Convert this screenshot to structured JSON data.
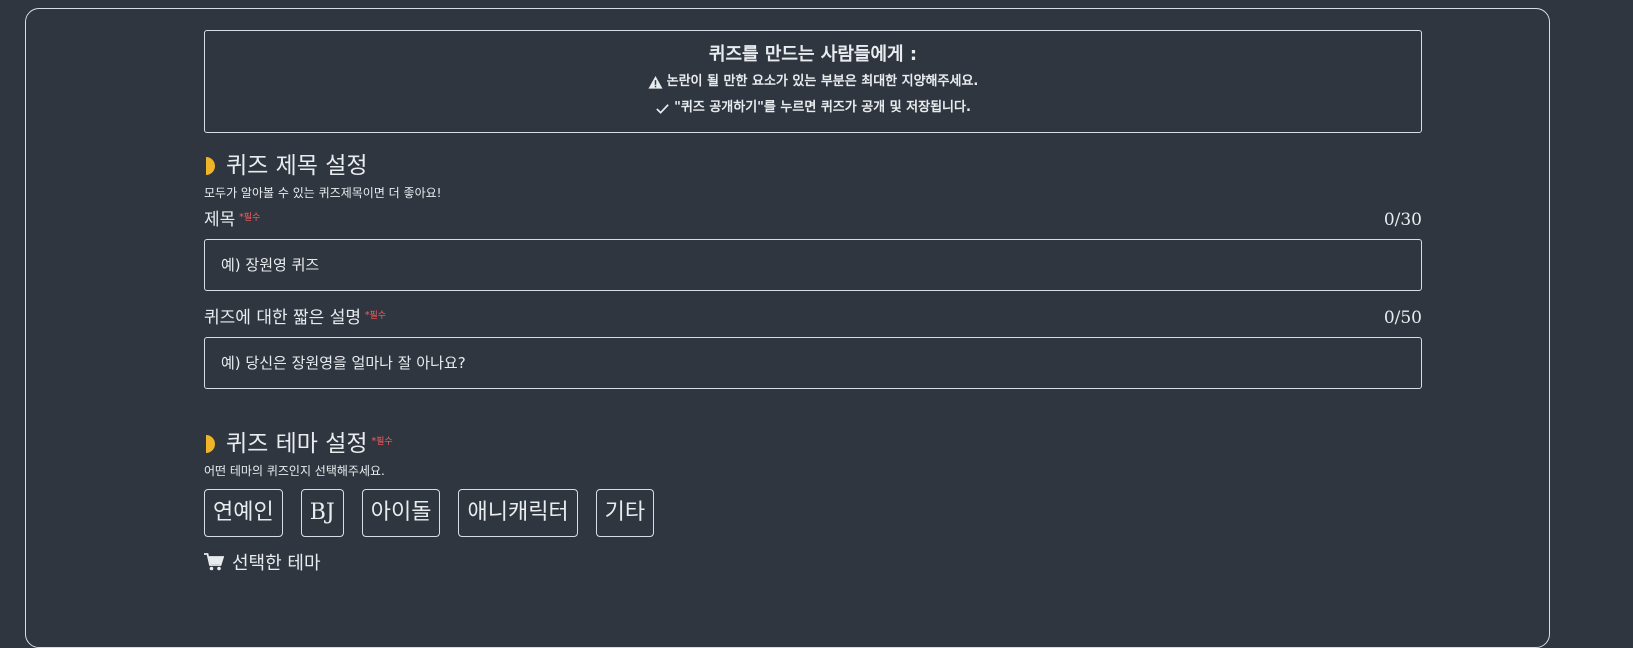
{
  "notice": {
    "title": "퀴즈를 만드는 사람들에게 :",
    "line1": "논란이 될 만한 요소가 있는 부분은 최대한 지양해주세요.",
    "line2": "\"퀴즈 공개하기\"를 누르면 퀴즈가 공개 및 저장됩니다."
  },
  "title_section": {
    "heading": "퀴즈 제목 설정",
    "subtitle": "모두가 알아볼 수 있는 퀴즈제목이면 더 좋아요!",
    "title_field": {
      "label": "제목",
      "required": "*필수",
      "counter": "0/30",
      "placeholder": "예) 장원영 퀴즈"
    },
    "desc_field": {
      "label": "퀴즈에 대한 짧은 설명",
      "required": "*필수",
      "counter": "0/50",
      "placeholder": "예) 당신은 장원영을 얼마나 잘 아나요?"
    }
  },
  "theme_section": {
    "heading": "퀴즈 테마 설정",
    "required": "*필수",
    "subtitle": "어떤 테마의 퀴즈인지 선택해주세요.",
    "options": [
      "연예인",
      "BJ",
      "아이돌",
      "애니캐릭터",
      "기타"
    ],
    "selected_label": "선택한 테마"
  },
  "colors": {
    "background": "#2f3640",
    "accent": "#f0b429",
    "required": "#ff5b5b",
    "border": "#d9dde3"
  },
  "icons": {
    "warning": "warning-triangle-icon",
    "check": "check-icon",
    "marker": "half-circle-marker-icon",
    "cart": "shopping-cart-icon"
  }
}
